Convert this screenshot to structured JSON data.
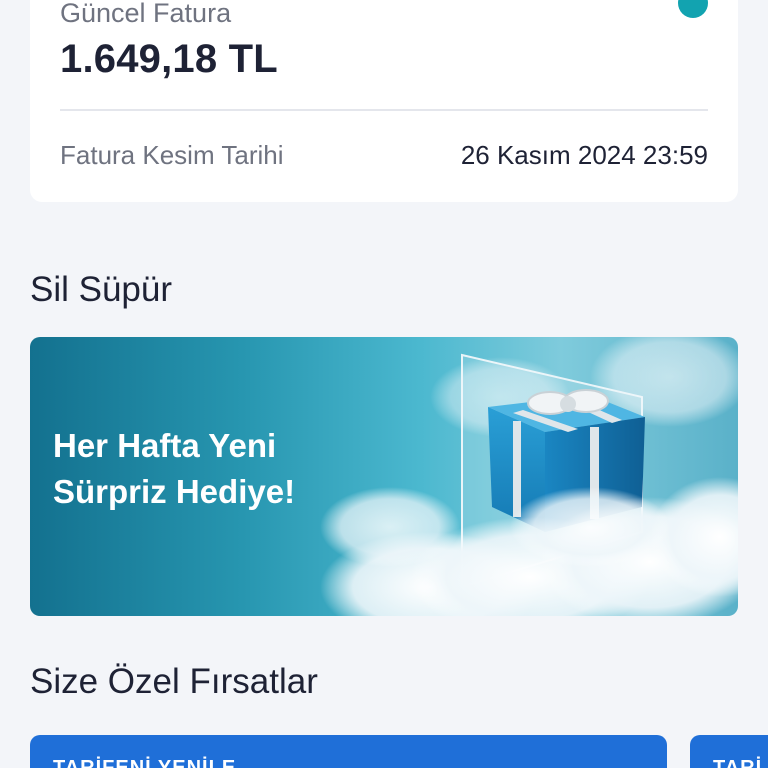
{
  "invoice": {
    "title": "Güncel Fatura",
    "amount": "1.649,18 TL",
    "cut_date_label": "Fatura Kesim Tarihi",
    "cut_date_value": "26 Kasım 2024 23:59",
    "accent_color": "#12a3b0"
  },
  "sweep_section": {
    "title": "Sil Süpür",
    "banner_line1": "Her Hafta Yeni",
    "banner_line2": "Sürpriz Hediye!"
  },
  "offers_section": {
    "title": "Size Özel Fırsatlar",
    "cards": [
      {
        "label": "TARİFENİ YENİLE"
      },
      {
        "label": "TARİ"
      }
    ],
    "card_color": "#1f6fd8"
  }
}
